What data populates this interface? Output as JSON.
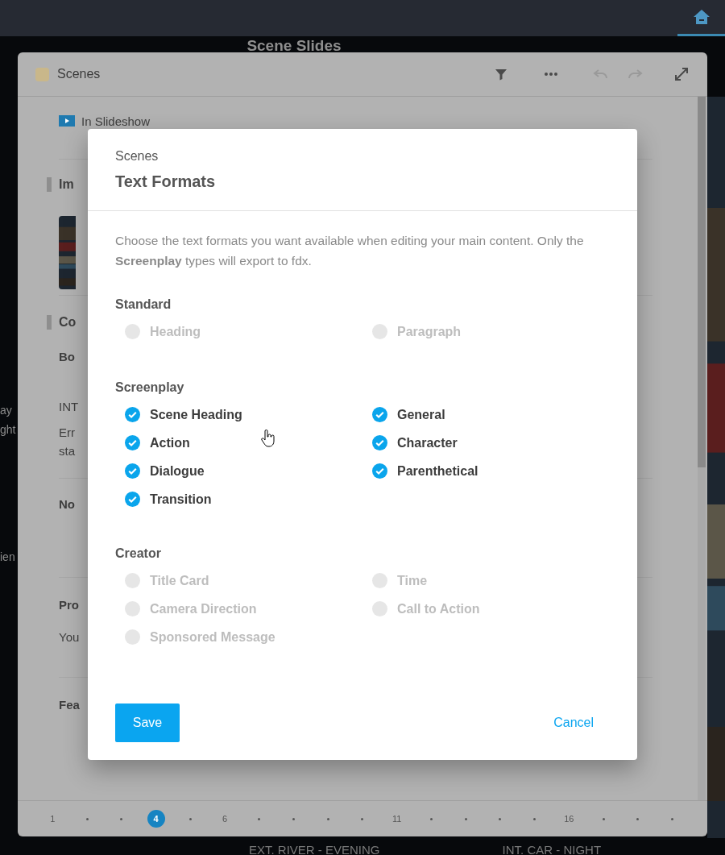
{
  "page_title": "Scene Slides",
  "panel": {
    "title": "Scenes",
    "color": "#c9b78a",
    "toolbar": [
      {
        "kind": "filter",
        "disabled": false
      },
      {
        "kind": "more",
        "disabled": false
      },
      {
        "kind": "undo",
        "disabled": true
      },
      {
        "kind": "redo",
        "disabled": true
      },
      {
        "kind": "expand",
        "disabled": false
      }
    ]
  },
  "background_texts": {
    "slideshow": "In Slideshow",
    "section_1": "Im",
    "section_2": "Co",
    "field_1": "Bo",
    "line_1": "INT",
    "line_2": "Err",
    "line_3": "sta",
    "field_2": "No",
    "field_3": "Pro",
    "line_4": "You",
    "field_4": "Fea"
  },
  "side_texts": [
    "ay",
    "ght",
    "ien"
  ],
  "dialog": {
    "subtitle": "Scenes",
    "title": "Text Formats",
    "description": "Choose the text formats you want available when editing your main content. Only the **Screenplay** types will export to fdx.",
    "groups": [
      {
        "title": "Standard",
        "options": [
          {
            "label": "Heading",
            "checked": false
          },
          {
            "label": "Paragraph",
            "checked": false
          }
        ]
      },
      {
        "title": "Screenplay",
        "options": [
          {
            "label": "Scene Heading",
            "checked": true
          },
          {
            "label": "General",
            "checked": true
          },
          {
            "label": "Action",
            "checked": true
          },
          {
            "label": "Character",
            "checked": true
          },
          {
            "label": "Dialogue",
            "checked": true
          },
          {
            "label": "Parenthetical",
            "checked": true
          },
          {
            "label": "Transition",
            "checked": true
          }
        ]
      },
      {
        "title": "Creator",
        "options": [
          {
            "label": "Title Card",
            "checked": false
          },
          {
            "label": "Time",
            "checked": false
          },
          {
            "label": "Camera Direction",
            "checked": false
          },
          {
            "label": "Call to Action",
            "checked": false
          },
          {
            "label": "Sponsored Message",
            "checked": false
          }
        ]
      }
    ],
    "save": "Save",
    "cancel": "Cancel"
  },
  "pager": [
    {
      "kind": "number",
      "label": "1",
      "selected": false
    },
    {
      "kind": "dot"
    },
    {
      "kind": "dot"
    },
    {
      "kind": "number",
      "label": "4",
      "selected": true
    },
    {
      "kind": "dot"
    },
    {
      "kind": "number",
      "label": "6",
      "selected": false
    },
    {
      "kind": "dot"
    },
    {
      "kind": "dot"
    },
    {
      "kind": "dot"
    },
    {
      "kind": "dot"
    },
    {
      "kind": "number",
      "label": "11",
      "selected": false
    },
    {
      "kind": "dot"
    },
    {
      "kind": "dot"
    },
    {
      "kind": "dot"
    },
    {
      "kind": "dot"
    },
    {
      "kind": "number",
      "label": "16",
      "selected": false
    },
    {
      "kind": "dot"
    },
    {
      "kind": "dot"
    },
    {
      "kind": "dot"
    }
  ],
  "scene_labels": [
    "EXT. RIVER - EVENING",
    "INT. CAR - NIGHT"
  ]
}
